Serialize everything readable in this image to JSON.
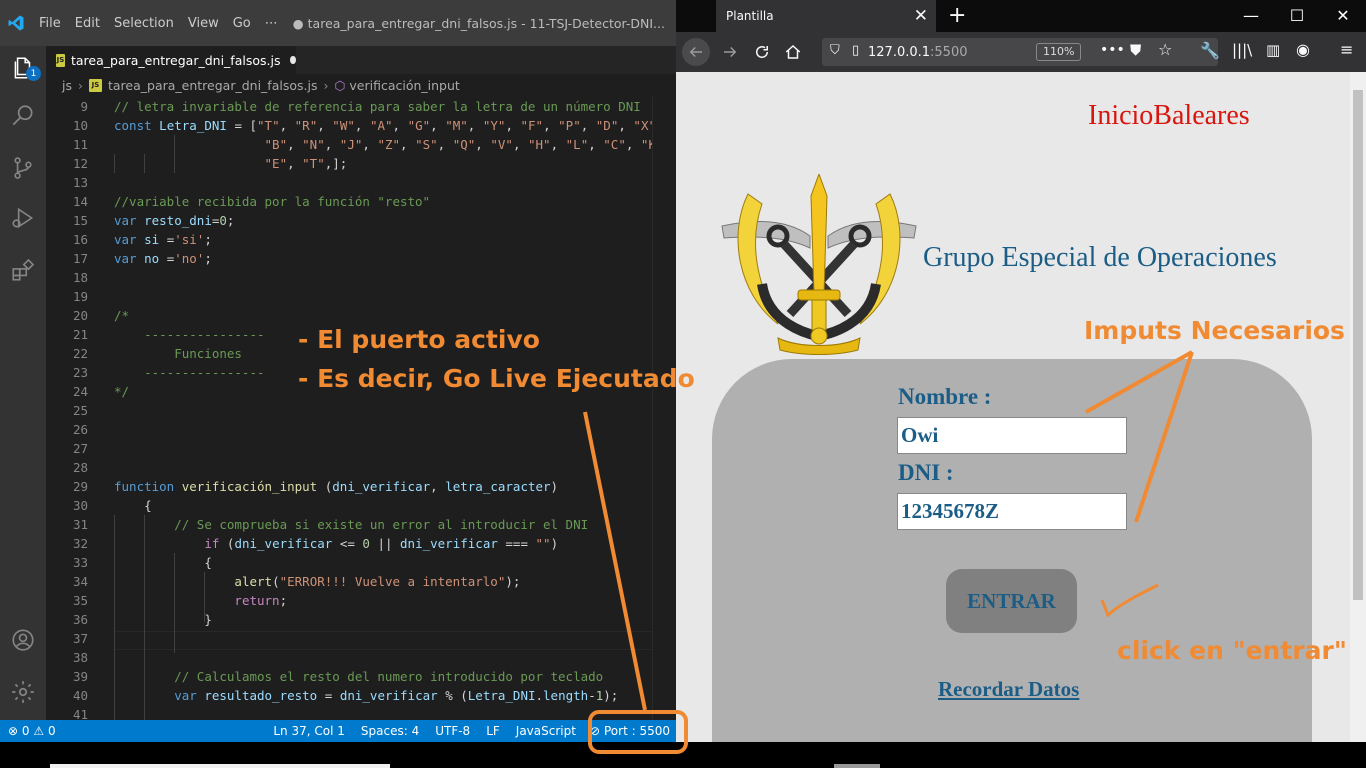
{
  "vscode": {
    "menu": [
      "File",
      "Edit",
      "Selection",
      "View",
      "Go",
      "⋯"
    ],
    "window_title": "● tarea_para_entregar_dni_falsos.js - 11-TSJ-Detector-DNI...",
    "tab_label": "tarea_para_entregar_dni_falsos.js",
    "breadcrumb": [
      "js",
      "tarea_para_entregar_dni_falsos.js",
      "verificación_input"
    ],
    "activity_badge": "1",
    "code_lines": [
      {
        "n": "9",
        "html": "<span class='cm'>// letra invariable de referencia para saber la letra de un número DNI</span>"
      },
      {
        "n": "10",
        "html": "<span class='kw'>const</span> <span class='var'>Letra_DNI</span> <span class='pl'>= [</span><span class='str'>\"T\"</span><span class='pl'>, </span><span class='str'>\"R\"</span><span class='pl'>, </span><span class='str'>\"W\"</span><span class='pl'>, </span><span class='str'>\"A\"</span><span class='pl'>, </span><span class='str'>\"G\"</span><span class='pl'>, </span><span class='str'>\"M\"</span><span class='pl'>, </span><span class='str'>\"Y\"</span><span class='pl'>, </span><span class='str'>\"F\"</span><span class='pl'>, </span><span class='str'>\"P\"</span><span class='pl'>, </span><span class='str'>\"D\"</span><span class='pl'>, </span><span class='str'>\"X\"</span>"
      },
      {
        "n": "11",
        "html": "                    <span class='str'>\"B\"</span><span class='pl'>, </span><span class='str'>\"N\"</span><span class='pl'>, </span><span class='str'>\"J\"</span><span class='pl'>, </span><span class='str'>\"Z\"</span><span class='pl'>, </span><span class='str'>\"S\"</span><span class='pl'>, </span><span class='str'>\"Q\"</span><span class='pl'>, </span><span class='str'>\"V\"</span><span class='pl'>, </span><span class='str'>\"H\"</span><span class='pl'>, </span><span class='str'>\"L\"</span><span class='pl'>, </span><span class='str'>\"C\"</span><span class='pl'>, </span><span class='str'>\"K\"</span>"
      },
      {
        "n": "12",
        "html": "                    <span class='str'>\"E\"</span><span class='pl'>, </span><span class='str'>\"T\"</span><span class='pl'>,];</span>"
      },
      {
        "n": "13",
        "html": ""
      },
      {
        "n": "14",
        "html": "<span class='cm'>//variable recibida por la función \"resto\"</span>"
      },
      {
        "n": "15",
        "html": "<span class='kw'>var</span> <span class='var'>resto_dni</span><span class='pl'>=</span><span class='num'>0</span><span class='pl'>;</span>"
      },
      {
        "n": "16",
        "html": "<span class='kw'>var</span> <span class='var'>si</span> <span class='pl'>=</span><span class='str'>'si'</span><span class='pl'>;</span>"
      },
      {
        "n": "17",
        "html": "<span class='kw'>var</span> <span class='var'>no</span> <span class='pl'>=</span><span class='str'>'no'</span><span class='pl'>;</span>"
      },
      {
        "n": "18",
        "html": ""
      },
      {
        "n": "19",
        "html": ""
      },
      {
        "n": "20",
        "html": "<span class='cm'>/*</span>"
      },
      {
        "n": "21",
        "html": "<span class='cm'>    ----------------</span>"
      },
      {
        "n": "22",
        "html": "<span class='cm'>        Funciones</span>"
      },
      {
        "n": "23",
        "html": "<span class='cm'>    ----------------</span>"
      },
      {
        "n": "24",
        "html": "<span class='cm'>*/</span>"
      },
      {
        "n": "25",
        "html": ""
      },
      {
        "n": "26",
        "html": ""
      },
      {
        "n": "27",
        "html": ""
      },
      {
        "n": "28",
        "html": ""
      },
      {
        "n": "29",
        "html": "<span class='kw'>function</span> <span class='fn'>verificación_input</span> <span class='pl'>(</span><span class='var'>dni_verificar</span><span class='pl'>, </span><span class='var'>letra_caracter</span><span class='pl'>)</span>"
      },
      {
        "n": "30",
        "html": "    <span class='pl'>{</span>"
      },
      {
        "n": "31",
        "html": "        <span class='cm'>// Se comprueba si existe un error al introducir el DNI</span>"
      },
      {
        "n": "32",
        "html": "            <span class='ctrl'>if</span> <span class='pl'>(</span><span class='var'>dni_verificar</span> <span class='pl'>&lt;= </span><span class='num'>0</span> <span class='pl'>|| </span><span class='var'>dni_verificar</span> <span class='pl'>=== </span><span class='str'>\"\"</span><span class='pl'>)</span>"
      },
      {
        "n": "33",
        "html": "            <span class='pl'>{</span>"
      },
      {
        "n": "34",
        "html": "                <span class='fn'>alert</span><span class='pl'>(</span><span class='str'>\"ERROR!!! Vuelve a intentarlo\"</span><span class='pl'>);</span>"
      },
      {
        "n": "35",
        "html": "                <span class='ctrl'>return</span><span class='pl'>;</span>"
      },
      {
        "n": "36",
        "html": "            <span class='pl'>}</span>"
      },
      {
        "n": "37",
        "html": ""
      },
      {
        "n": "38",
        "html": ""
      },
      {
        "n": "39",
        "html": "        <span class='cm'>// Calculamos el resto del numero introducido por teclado</span>"
      },
      {
        "n": "40",
        "html": "        <span class='kw'>var</span> <span class='var'>resultado_resto</span> <span class='pl'>= </span><span class='var'>dni_verificar</span> <span class='pl'>% (</span><span class='var'>Letra_DNI</span><span class='pl'>.</span><span class='var'>length</span><span class='pl'>-</span><span class='num'>1</span><span class='pl'>);</span>"
      },
      {
        "n": "41",
        "html": ""
      }
    ],
    "status": {
      "errors": "0",
      "warnings": "0",
      "position": "Ln 37, Col 1",
      "spaces": "Spaces: 4",
      "encoding": "UTF-8",
      "eol": "LF",
      "language": "JavaScript",
      "port": "Port : 5500"
    }
  },
  "annotations": {
    "left_line1": "- El puerto activo",
    "left_line2": "- Es decir, Go Live Ejecutado",
    "inputs": "Imputs Necesarios",
    "click": "click en \"entrar\"",
    "color": "#f08a33"
  },
  "firefox": {
    "tab_title": "Plantilla",
    "url_host": "127.0.0.1",
    "url_port": ":5500",
    "zoom": "110%"
  },
  "page": {
    "top_link": "InicioBaleares",
    "title": "Grupo Especial de Operaciones",
    "name_label": "Nombre :",
    "name_value": "Owi",
    "dni_label": "DNI :",
    "dni_value": "12345678Z",
    "submit_label": "ENTRAR",
    "remember_link": "Recordar Datos"
  }
}
